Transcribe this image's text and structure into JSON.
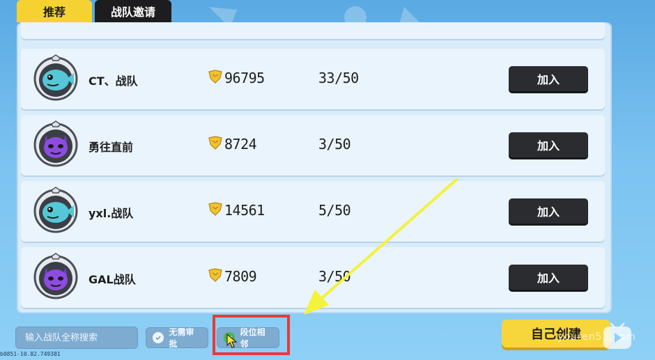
{
  "tabs": [
    {
      "label": "推荐",
      "active": true
    },
    {
      "label": "战队邀请",
      "active": false
    }
  ],
  "teams": [
    {
      "name": "CT、战队",
      "score": "96795",
      "members": "33/50",
      "emblem": "blue-fish-emblem-icon",
      "join_label": "加入"
    },
    {
      "name": "勇往直前",
      "score": "8724",
      "members": "3/50",
      "emblem": "purple-cat-emblem-icon",
      "join_label": "加入"
    },
    {
      "name": "yxl.战队",
      "score": "14561",
      "members": "5/50",
      "emblem": "blue-fish-emblem-icon",
      "join_label": "加入"
    },
    {
      "name": "GAL战队",
      "score": "7809",
      "members": "3/50",
      "emblem": "purple-cat-emblem-icon",
      "join_label": "加入"
    }
  ],
  "bottom": {
    "search_placeholder": "输入战队全称搜索",
    "no_approve_label": "无需审批",
    "rank_near_label": "段位相邻",
    "create_label": "自己创建"
  },
  "watermark": "youren51.com",
  "debug_text": "b0851-10.82.749381",
  "colors": {
    "tab_active": "#f5d232",
    "tab_inactive": "#1d1d1f",
    "join_button": "#2b2c30",
    "create_button": "#f7d63c",
    "highlight": "#e8393a",
    "arrow": "#f4f23a",
    "check_on": "#4ab553"
  }
}
